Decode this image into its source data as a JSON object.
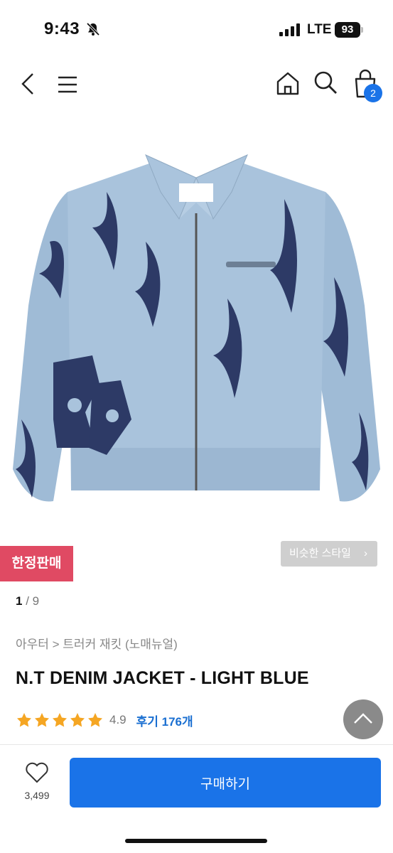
{
  "status_bar": {
    "time": "9:43",
    "network": "LTE",
    "battery": "93"
  },
  "nav": {
    "back_icon": "chevron-left-icon",
    "menu_icon": "hamburger-icon",
    "home_icon": "home-icon",
    "search_icon": "search-icon",
    "cart_icon": "shopping-bag-icon",
    "cart_count": "2"
  },
  "product": {
    "limited_badge": "한정판매",
    "similar_style_label": "비슷한 스타일",
    "image_index": "1",
    "image_total": "/ 9",
    "breadcrumb": "아우터 > 트러커 재킷 (노매뉴얼)",
    "title": "N.T DENIM JACKET - LIGHT BLUE",
    "rating": 4.9,
    "rating_text": "4.9",
    "review_label": "후기 176개",
    "like_count": "3,499"
  },
  "actions": {
    "buy_label": "구매하기"
  },
  "colors": {
    "accent": "#1a73e8",
    "badge": "#e04a63",
    "star": "#f5a623",
    "denim": "#9fbbd6",
    "print": "#2d3a66"
  }
}
